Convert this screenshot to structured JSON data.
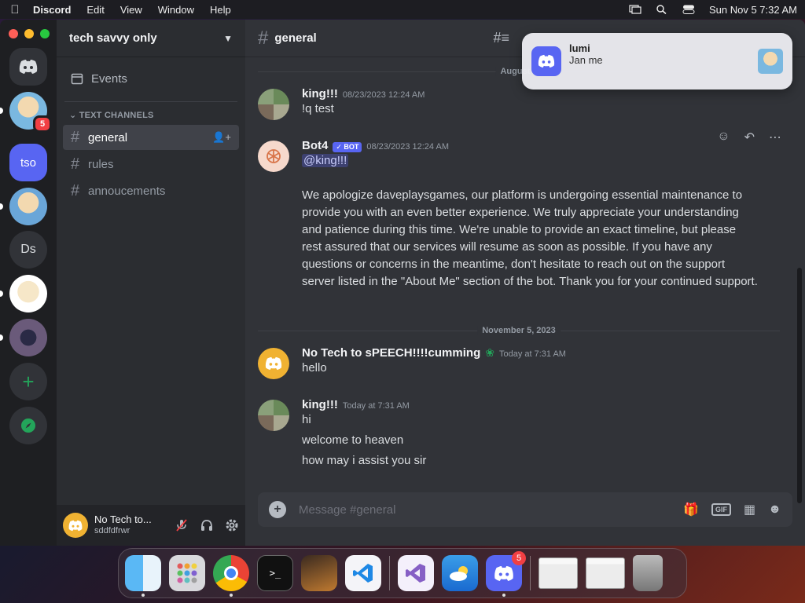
{
  "menubar": {
    "app_name": "Discord",
    "items": [
      "Edit",
      "View",
      "Window",
      "Help"
    ],
    "clock": "Sun Nov 5  7:32 AM"
  },
  "servers": {
    "tso_label": "tso",
    "ds_label": "Ds",
    "badge": "5"
  },
  "sidebar": {
    "guild_name": "tech savvy only",
    "events_label": "Events",
    "category": "TEXT CHANNELS",
    "channels": [
      {
        "name": "general"
      },
      {
        "name": "rules"
      },
      {
        "name": "annoucements"
      }
    ]
  },
  "user_panel": {
    "name": "No Tech to...",
    "sub": "sddfdfrwr"
  },
  "chat": {
    "channel": "general",
    "date1": "August 2",
    "date2": "November 5, 2023",
    "messages": [
      {
        "author": "king!!!",
        "ts": "08/23/2023 12:24 AM",
        "lines": [
          "!q test"
        ]
      },
      {
        "author": "Bot4",
        "bot_tag": "✓ BOT",
        "ts": "08/23/2023 12:24 AM",
        "mention": "@king!!!",
        "lines": [
          "We apologize daveplaysgames, our platform is undergoing essential maintenance to provide you with an even better experience. We truly appreciate your understanding and patience during this time. We're unable to provide an exact timeline, but please rest assured that our services will resume as soon as possible. If you have any questions or concerns in the meantime, don't hesitate to reach out on the support server listed in the \"About Me\" section of the bot. Thank you for your continued support."
        ]
      },
      {
        "author": "No Tech to sPEECH!!!!cumming",
        "ts": "Today at 7:31 AM",
        "lines": [
          "hello"
        ]
      },
      {
        "author": "king!!!",
        "ts": "Today at 7:31 AM",
        "lines": [
          "hi",
          "welcome to heaven",
          "how may i assist you sir"
        ]
      }
    ],
    "composer_placeholder": "Message #general"
  },
  "notification": {
    "title": "lumi",
    "body": "Jan me"
  },
  "dock": {
    "discord_badge": "5",
    "terminal_glyph": ">_"
  }
}
